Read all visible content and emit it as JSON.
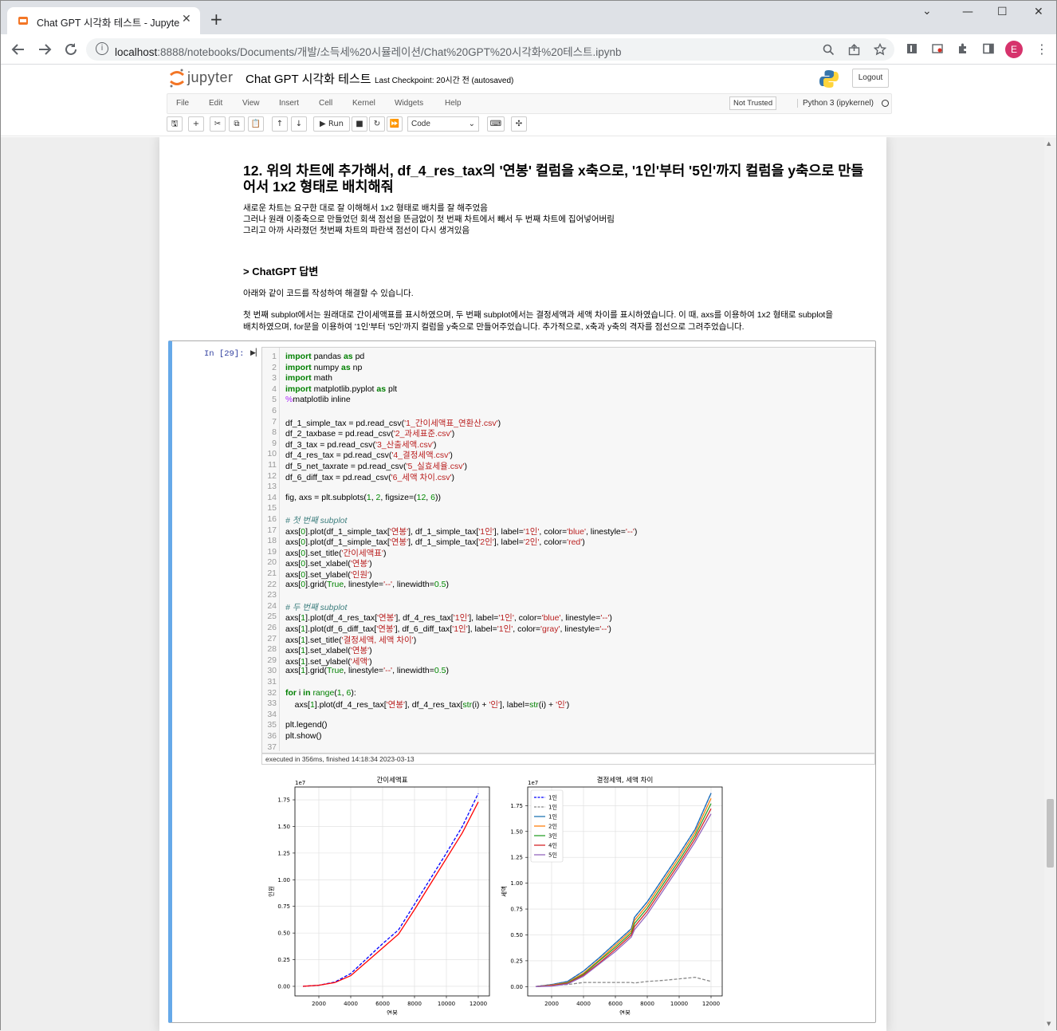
{
  "browser": {
    "tab_title": "Chat GPT 시각화 테스트 - Jupyter",
    "tab_close": "✕",
    "new_tab": "+",
    "url_host": "localhost",
    "url_rest": ":8888/notebooks/Documents/개발/소득세%20시뮬레이션/Chat%20GPT%20시각화%20테스트.ipynb",
    "profile_initial": "E",
    "window_controls": [
      "⌄",
      "—",
      "☐",
      "✕"
    ]
  },
  "jupyter": {
    "logo_text": "jupyter",
    "notebook_title": "Chat GPT 시각화 테스트",
    "checkpoint": "Last Checkpoint: 20시간 전   (autosaved)",
    "logout": "Logout",
    "menu": [
      "File",
      "Edit",
      "View",
      "Insert",
      "Cell",
      "Kernel",
      "Widgets",
      "Help"
    ],
    "trust": "Not Trusted",
    "kernel": "Python 3 (ipykernel)",
    "run_label": "Run",
    "cell_type": "Code"
  },
  "markdown": {
    "heading": "12. 위의 차트에 추가해서, df_4_res_tax의 '연봉' 컬럼을 x축으로, '1인'부터 '5인'까지 컬럼을 y축으로 만들어서 1x2 형태로 배치해줘",
    "notes": [
      "새로운 차트는 요구한 대로 잘 이해해서 1x2 형태로 배치를 잘 해주었음",
      "그러나 원래 이중축으로 만들었던 회색 점선을 뜬금없이 첫 번째 차트에서 빼서 두 번째 차트에 집어넣어버림",
      "그리고 아까 사라졌던 첫번째 차트의 파란색 점선이 다시 생겨있음"
    ],
    "answer_heading": "> ChatGPT 답변",
    "answer_p1": "아래와 같이 코드를 작성하여 해결할 수 있습니다.",
    "answer_p2_line1": "첫 번째 subplot에서는 원래대로 간이세액표를 표시하였으며, 두 번째 subplot에서는 결정세액과 세액 차이를 표시하였습니다. 이 때, axs를 이용하여 1x2 형태로 subplot을",
    "answer_p2_line2": "배치하였으며, for문을 이용하여 '1인'부터 '5인'까지 컬럼을 y축으로 만들어주었습니다. 추가적으로, x축과 y축의 격자를 점선으로 그려주었습니다."
  },
  "cell": {
    "prompt": "In [29]:",
    "exec_info": "executed in 356ms, finished 14:18:34 2023-03-13",
    "line_numbers": [
      "1",
      "2",
      "3",
      "4",
      "5",
      "6",
      "7",
      "8",
      "9",
      "10",
      "11",
      "12",
      "13",
      "14",
      "15",
      "16",
      "17",
      "18",
      "19",
      "20",
      "21",
      "22",
      "23",
      "24",
      "25",
      "26",
      "27",
      "28",
      "29",
      "30",
      "31",
      "32",
      "33",
      "34",
      "35",
      "36",
      "37"
    ]
  },
  "chart_data": [
    {
      "type": "line",
      "title": "간이세액표",
      "xlabel": "연봉",
      "ylabel": "인원",
      "y_multiplier": "1e7",
      "xticks": [
        "2000",
        "4000",
        "6000",
        "8000",
        "10000",
        "12000"
      ],
      "yticks": [
        "0.00",
        "0.25",
        "0.50",
        "0.75",
        "1.00",
        "1.25",
        "1.50",
        "1.75"
      ],
      "xlim": [
        500,
        12700
      ],
      "ylim": [
        -0.09,
        1.87
      ],
      "grid": true,
      "x": [
        1000,
        2000,
        3000,
        4000,
        5000,
        6000,
        7000,
        8000,
        9000,
        10000,
        11000,
        12000
      ],
      "series": [
        {
          "name": "1인",
          "color": "#0000ff",
          "dash": true,
          "values": [
            0.0,
            0.01,
            0.04,
            0.12,
            0.26,
            0.4,
            0.53,
            0.77,
            1.01,
            1.25,
            1.5,
            1.81
          ]
        },
        {
          "name": "2인",
          "color": "#ff0000",
          "dash": false,
          "values": [
            0.0,
            0.01,
            0.035,
            0.1,
            0.23,
            0.36,
            0.49,
            0.72,
            0.96,
            1.2,
            1.44,
            1.73
          ]
        }
      ]
    },
    {
      "type": "line",
      "title": "결정세액, 세액 차이",
      "xlabel": "연봉",
      "ylabel": "세액",
      "y_multiplier": "1e7",
      "xticks": [
        "2000",
        "4000",
        "6000",
        "8000",
        "10000",
        "12000"
      ],
      "yticks": [
        "0.00",
        "0.25",
        "0.50",
        "0.75",
        "1.00",
        "1.25",
        "1.50",
        "1.75"
      ],
      "xlim": [
        500,
        12700
      ],
      "ylim": [
        -0.09,
        1.93
      ],
      "grid": true,
      "legend_position": "top-left",
      "x": [
        1000,
        2000,
        3000,
        4000,
        5000,
        6000,
        7000,
        7200,
        8000,
        9000,
        10000,
        11000,
        12000
      ],
      "series": [
        {
          "name": "1인",
          "color": "#0000ff",
          "dash": true,
          "values": [
            0.0,
            0.02,
            0.05,
            0.15,
            0.28,
            0.42,
            0.56,
            0.67,
            0.82,
            1.05,
            1.28,
            1.52,
            1.87
          ]
        },
        {
          "name": "1인",
          "color": "#888888",
          "dash": true,
          "values": [
            0.0,
            0.01,
            0.02,
            0.04,
            0.04,
            0.04,
            0.04,
            0.035,
            0.05,
            0.06,
            0.075,
            0.09,
            0.05
          ]
        },
        {
          "name": "1인",
          "color": "#1f77b4",
          "dash": false,
          "values": [
            0.0,
            0.02,
            0.05,
            0.15,
            0.28,
            0.42,
            0.56,
            0.67,
            0.82,
            1.05,
            1.28,
            1.52,
            1.87
          ]
        },
        {
          "name": "2인",
          "color": "#ff7f0e",
          "dash": false,
          "values": [
            0.0,
            0.015,
            0.04,
            0.13,
            0.26,
            0.4,
            0.54,
            0.64,
            0.79,
            1.02,
            1.25,
            1.49,
            1.82
          ]
        },
        {
          "name": "3인",
          "color": "#2ca02c",
          "dash": false,
          "values": [
            0.0,
            0.01,
            0.035,
            0.12,
            0.25,
            0.38,
            0.52,
            0.61,
            0.76,
            0.99,
            1.22,
            1.46,
            1.77
          ]
        },
        {
          "name": "4인",
          "color": "#d62728",
          "dash": false,
          "values": [
            0.0,
            0.01,
            0.03,
            0.11,
            0.23,
            0.36,
            0.5,
            0.58,
            0.73,
            0.96,
            1.19,
            1.43,
            1.72
          ]
        },
        {
          "name": "5인",
          "color": "#9467bd",
          "dash": false,
          "values": [
            0.0,
            0.005,
            0.025,
            0.1,
            0.22,
            0.34,
            0.48,
            0.55,
            0.7,
            0.93,
            1.16,
            1.4,
            1.67
          ]
        }
      ]
    }
  ]
}
